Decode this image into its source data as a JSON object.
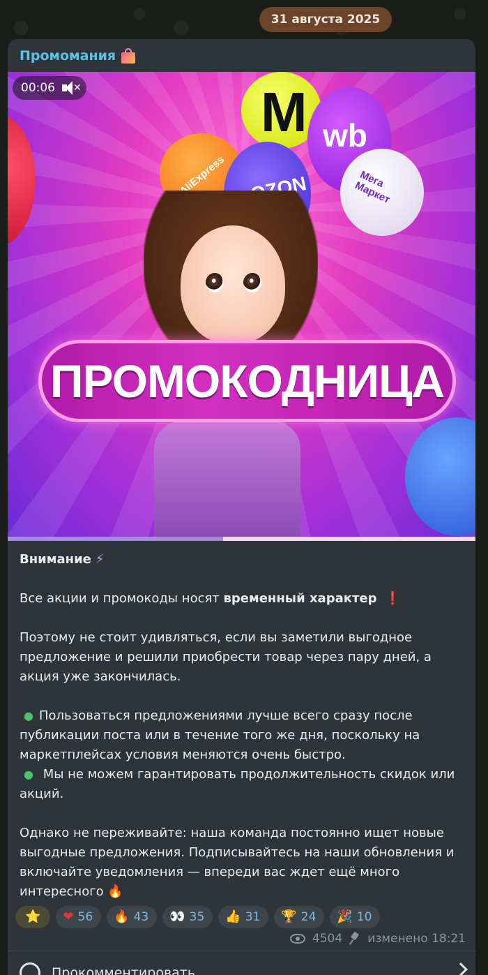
{
  "date": "31 августа 2025",
  "channel": {
    "name": "Промомания",
    "icon": "shopping-bags-icon"
  },
  "video": {
    "time": "00:06",
    "muted": true,
    "banner_text": "ПРОМОКОДНИЦА",
    "balloons": [
      "AliExpress",
      "OZON",
      "M",
      "wb",
      "Мега Маркет"
    ],
    "progress": 0.46
  },
  "post": {
    "heading": "Внимание",
    "heading_emoji": "⚡",
    "p1_prefix": "Все акции и промокоды носят ",
    "p1_bold": "временный характер",
    "p1_emoji": "❗",
    "p2": "Поэтому не стоит удивляться, если вы заметили выгодное предложение и решили приобрести товар через пару дней, а акция уже закончилась.",
    "bullets": [
      "Пользоваться предложениями лучше всего сразу после публикации поста или в течение того же дня, поскольку на маркетплейсах условия меняются очень быстро.",
      "Мы не можем гарантировать продолжительность скидок или акций."
    ],
    "p3": "Однако не переживайте: наша команда постоянно ищет новые выгодные предложения. Подписывайтесь на наши обновления и включайте уведомления — впереди вас ждет ещё много интересного",
    "p3_emoji": "🔥"
  },
  "reactions": [
    {
      "emoji": "⭐",
      "count": ""
    },
    {
      "emoji": "❤",
      "count": "56"
    },
    {
      "emoji": "🔥",
      "count": "43"
    },
    {
      "emoji": "👀",
      "count": "35"
    },
    {
      "emoji": "👍",
      "count": "31"
    },
    {
      "emoji": "🏆",
      "count": "24"
    },
    {
      "emoji": "🎉",
      "count": "10"
    }
  ],
  "meta": {
    "views": "4504",
    "edited": "изменено 18:21"
  },
  "comment": {
    "label": "Прокомментировать"
  },
  "colors": {
    "channel": "#5bc2e7",
    "bubble": "#2e3438",
    "date_pill": "#6b4429",
    "reaction_count": "#7fb8e6"
  }
}
